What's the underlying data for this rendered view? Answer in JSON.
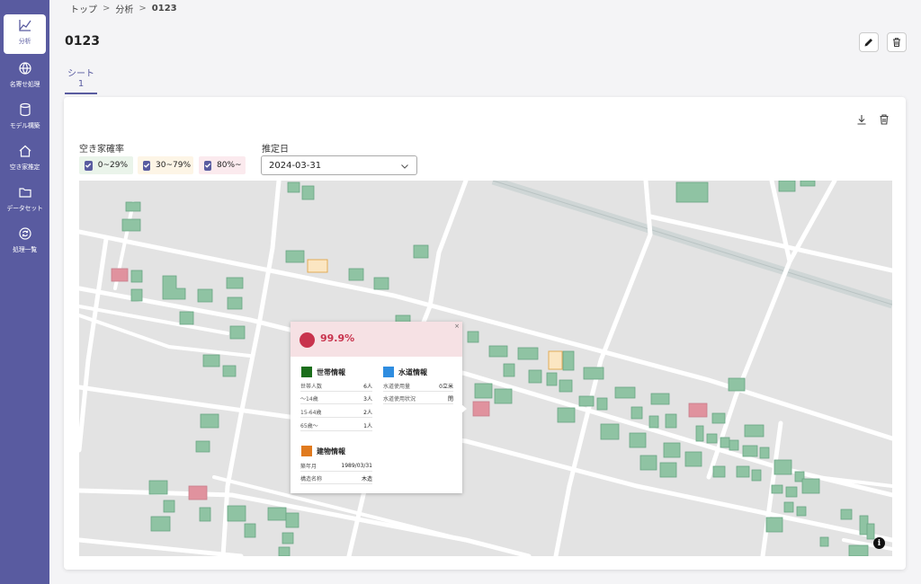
{
  "sidebar": {
    "items": [
      {
        "label": "分析",
        "icon": "chart-line-icon",
        "active": true
      },
      {
        "label": "名寄せ処理",
        "icon": "globe-icon",
        "active": false
      },
      {
        "label": "モデル構築",
        "icon": "database-icon",
        "active": false
      },
      {
        "label": "空き家推定",
        "icon": "home-icon",
        "active": false
      },
      {
        "label": "データセット",
        "icon": "folder-icon",
        "active": false
      },
      {
        "label": "処理一覧",
        "icon": "sync-icon",
        "active": false
      }
    ]
  },
  "breadcrumb": {
    "items": [
      "トップ",
      "分析",
      "0123"
    ],
    "separator": ">"
  },
  "page": {
    "title": "0123"
  },
  "tabs": [
    {
      "label": "シート1",
      "active": true
    }
  ],
  "filters": {
    "vacancy_label": "空き家確率",
    "chips": [
      {
        "label": "0~29%",
        "checked": true,
        "bg": "#eaf4ea"
      },
      {
        "label": "30~79%",
        "checked": true,
        "bg": "#fdf5e6"
      },
      {
        "label": "80%~",
        "checked": true,
        "bg": "#fbeaee"
      }
    ],
    "date_label": "推定日",
    "date_value": "2024-03-31"
  },
  "popup": {
    "close": "×",
    "probability": "99.9%",
    "household": {
      "title": "世帯情報",
      "color": "#1b6e1b",
      "rows": [
        {
          "k": "世帯人数",
          "v": "6人"
        },
        {
          "k": "〜14歳",
          "v": "3人"
        },
        {
          "k": "15-64歳",
          "v": "2人"
        },
        {
          "k": "65歳〜",
          "v": "1人"
        }
      ]
    },
    "water": {
      "title": "水道情報",
      "color": "#2f8de0",
      "rows": [
        {
          "k": "水道使用量",
          "v": "0立米"
        },
        {
          "k": "水道使用状況",
          "v": "閉"
        }
      ]
    },
    "building": {
      "title": "建物情報",
      "color": "#e07a1e",
      "rows": [
        {
          "k": "築年月",
          "v": "1989/03/31"
        },
        {
          "k": "構造名称",
          "v": "木造"
        }
      ]
    }
  },
  "map": {
    "info_glyph": "i"
  },
  "colors": {
    "accent": "#595ba0",
    "low": "#8fc3a3",
    "mid": "#fbe6c2",
    "high": "#e0929e"
  }
}
